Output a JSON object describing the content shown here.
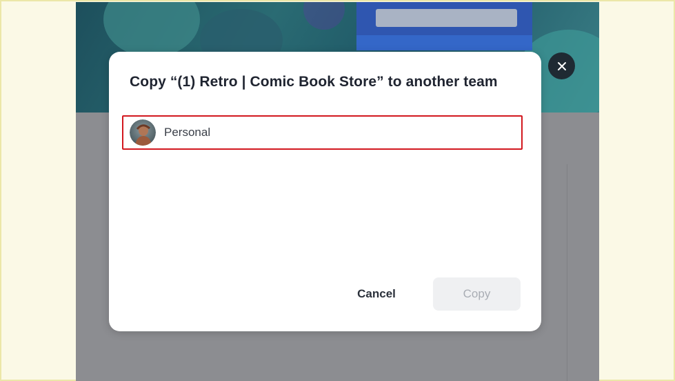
{
  "dialog": {
    "title": "Copy “(1) Retro | Comic Book Store” to another team",
    "options": [
      {
        "label": "Personal",
        "selected": true
      }
    ],
    "cancel_label": "Cancel",
    "copy_label": "Copy",
    "copy_disabled": true
  },
  "icons": {
    "close": "close-icon",
    "avatar": "user-avatar"
  },
  "colors": {
    "selection_border": "#d2171e",
    "close_button_bg": "#1f2a33",
    "disabled_button_bg": "#eff0f2",
    "disabled_button_text": "#a9adb4"
  }
}
